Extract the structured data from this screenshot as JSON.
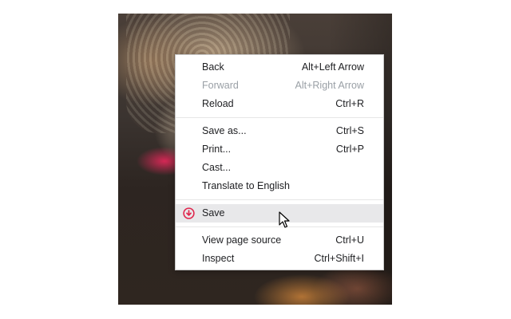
{
  "context_menu": {
    "groups": [
      [
        {
          "label": "Back",
          "shortcut": "Alt+Left Arrow",
          "disabled": false
        },
        {
          "label": "Forward",
          "shortcut": "Alt+Right Arrow",
          "disabled": true
        },
        {
          "label": "Reload",
          "shortcut": "Ctrl+R",
          "disabled": false
        }
      ],
      [
        {
          "label": "Save as...",
          "shortcut": "Ctrl+S",
          "disabled": false
        },
        {
          "label": "Print...",
          "shortcut": "Ctrl+P",
          "disabled": false
        },
        {
          "label": "Cast...",
          "shortcut": "",
          "disabled": false
        },
        {
          "label": "Translate to English",
          "shortcut": "",
          "disabled": false
        }
      ],
      [
        {
          "label": "Save",
          "shortcut": "",
          "disabled": false,
          "icon": "save-icon",
          "highlighted": true
        }
      ],
      [
        {
          "label": "View page source",
          "shortcut": "Ctrl+U",
          "disabled": false
        },
        {
          "label": "Inspect",
          "shortcut": "Ctrl+Shift+I",
          "disabled": false
        }
      ]
    ]
  },
  "colors": {
    "save_icon": "#e0264d",
    "highlight": "#e8e8ea",
    "disabled_text": "#9aa0a6",
    "text": "#202124"
  }
}
